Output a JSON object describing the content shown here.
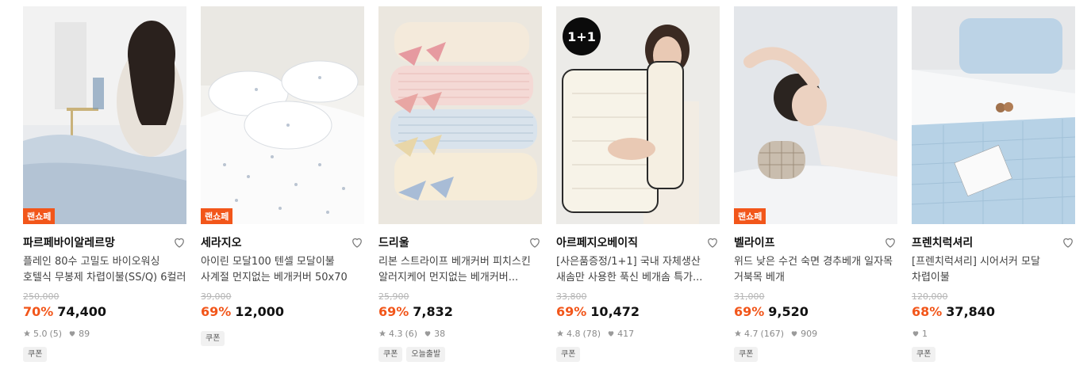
{
  "products": [
    {
      "tag": "랜쇼페",
      "brand": "파르페바이알레르망",
      "title": "플레인 80수 고밀도 바이오워싱 호텔식 무봉제 차렵이불(SS/Q) 6컬러",
      "original_price": "250,000",
      "discount": "70%",
      "price": "74,400",
      "rating": "5.0",
      "reviews": "(5)",
      "likes": "89",
      "chips": [
        "쿠폰"
      ]
    },
    {
      "tag": "랜쇼페",
      "brand": "세라지오",
      "title": "아이린 모달100 텐셀 모달이불 사계절 먼지없는 베개커버 50x70",
      "original_price": "39,000",
      "discount": "69%",
      "price": "12,000",
      "chips": [
        "쿠폰"
      ]
    },
    {
      "brand": "드리울",
      "title": "리본 스트라이프 베개커버 피치스킨 알러지케어 먼지없는 베개커버...",
      "original_price": "25,900",
      "discount": "69%",
      "price": "7,832",
      "rating": "4.3",
      "reviews": "(6)",
      "likes": "38",
      "chips": [
        "쿠폰",
        "오늘출발"
      ]
    },
    {
      "badge": "1+1",
      "brand": "아르페지오베이직",
      "title": "[사은품증정/1+1] 국내 자체생산 새솜만 사용한 푹신 베개솜 특가...",
      "original_price": "33,800",
      "discount": "69%",
      "price": "10,472",
      "rating": "4.8",
      "reviews": "(78)",
      "likes": "417",
      "chips": [
        "쿠폰"
      ]
    },
    {
      "tag": "랜쇼페",
      "brand": "벨라이프",
      "title": "위드 낮은 수건 숙면 경추베개 일자목 거북목 베개",
      "original_price": "31,000",
      "discount": "69%",
      "price": "9,520",
      "rating": "4.7",
      "reviews": "(167)",
      "likes": "909",
      "chips": [
        "쿠폰"
      ]
    },
    {
      "brand": "프렌치럭셔리",
      "title": "[프렌치럭셔리] 시어서커 모달 차렵이불",
      "original_price": "120,000",
      "discount": "68%",
      "price": "37,840",
      "likes": "1",
      "chips": [
        "쿠폰"
      ]
    }
  ],
  "images": [
    "bedroom-woman-sitting-in-bed",
    "white-floral-bedding",
    "ribbon-striped-pillows",
    "woman-hugging-pillows",
    "woman-on-neck-pillow",
    "blue-seersucker-blanket"
  ],
  "colors": {
    "accent": "#f2561a",
    "price": "#111111",
    "muted": "#8a8a8a",
    "strike": "#b5b5b5",
    "chip_bg": "#f1f1f1"
  },
  "icons": {
    "wishlist": "heart-outline-icon",
    "rating": "star-icon",
    "likes": "heart-filled-icon"
  }
}
